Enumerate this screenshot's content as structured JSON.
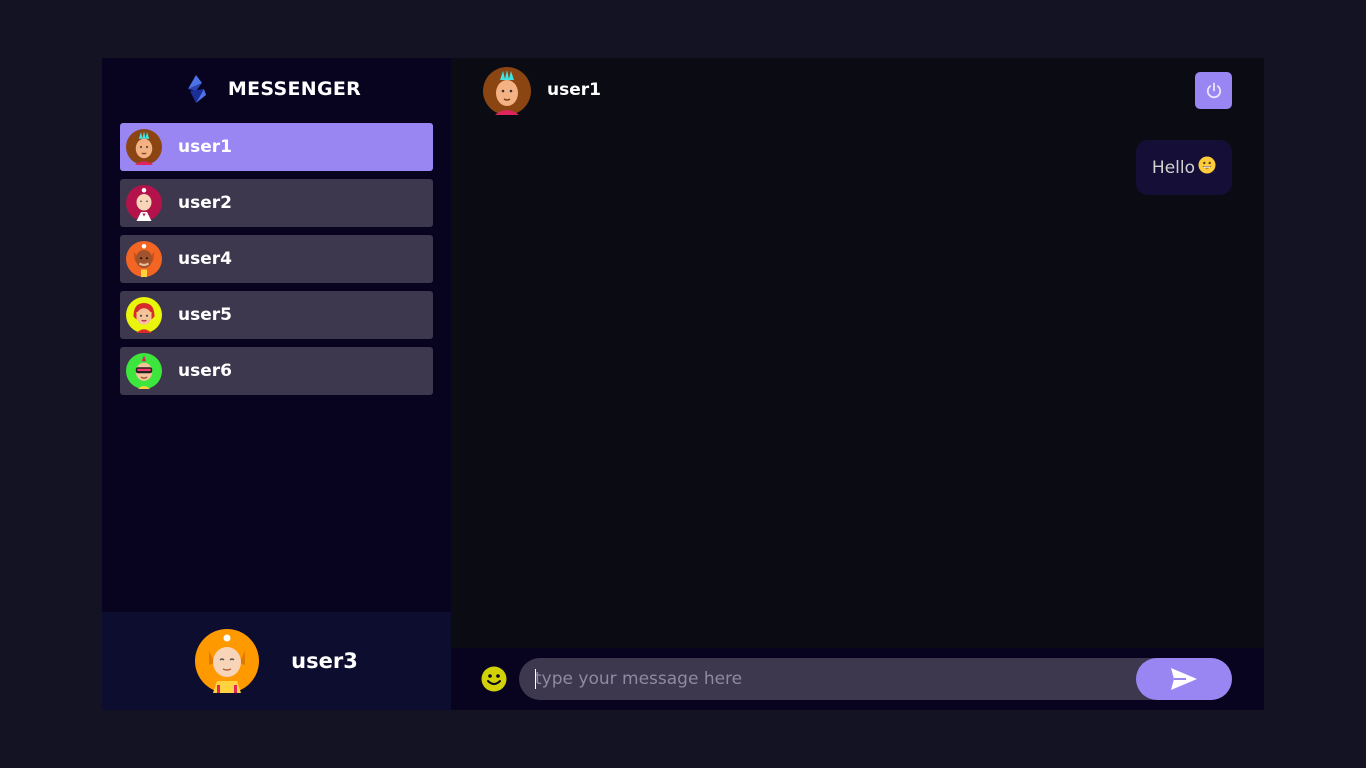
{
  "app": {
    "title": "MESSENGER",
    "logo_icon": "messenger-logo-icon"
  },
  "colors": {
    "accent": "#9a86f3",
    "sidebar_bg": "#080420",
    "contact_bg": "#3d384e",
    "chat_bg": "#0b0b13",
    "bubble_bg": "#150f37"
  },
  "contacts": [
    {
      "name": "user1",
      "selected": true,
      "avatar": "avatar-mohawk"
    },
    {
      "name": "user2",
      "selected": false,
      "avatar": "avatar-bald-red"
    },
    {
      "name": "user4",
      "selected": false,
      "avatar": "avatar-bear"
    },
    {
      "name": "user5",
      "selected": false,
      "avatar": "avatar-redhead"
    },
    {
      "name": "user6",
      "selected": false,
      "avatar": "avatar-visor"
    }
  ],
  "current_user": {
    "name": "user3",
    "avatar": "avatar-monk"
  },
  "chat": {
    "header_name": "user1",
    "logout_icon": "power-icon",
    "messages": [
      {
        "text": "Hello",
        "emoji": "😀",
        "sent": true
      }
    ],
    "input": {
      "placeholder": "type your message here",
      "value": ""
    },
    "emoji_icon": "smiley-icon",
    "send_icon": "send-icon"
  }
}
